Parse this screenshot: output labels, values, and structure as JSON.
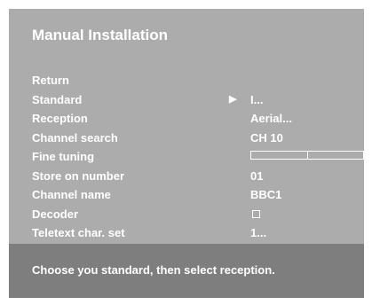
{
  "title": "Manual Installation",
  "menu": {
    "return_label": "Return",
    "standard": {
      "label": "Standard",
      "value": "I...",
      "arrow_icon": "play-arrow-icon"
    },
    "reception": {
      "label": "Reception",
      "value": "Aerial..."
    },
    "channel_search": {
      "label": "Channel search",
      "value": "CH 10"
    },
    "fine_tuning": {
      "label": "Fine tuning",
      "level": 0.5
    },
    "store_on_number": {
      "label": "Store on number",
      "value": "01"
    },
    "channel_name": {
      "label": "Channel name",
      "value": "BBC1"
    },
    "decoder": {
      "label": "Decoder",
      "checked": false
    },
    "teletext": {
      "label": "Teletext char. set",
      "value": "1..."
    }
  },
  "status": {
    "text": "Choose you standard, then select reception."
  },
  "colors": {
    "panel": "#acacac",
    "status_bar": "#7e7e7e",
    "text": "#ffffff"
  }
}
